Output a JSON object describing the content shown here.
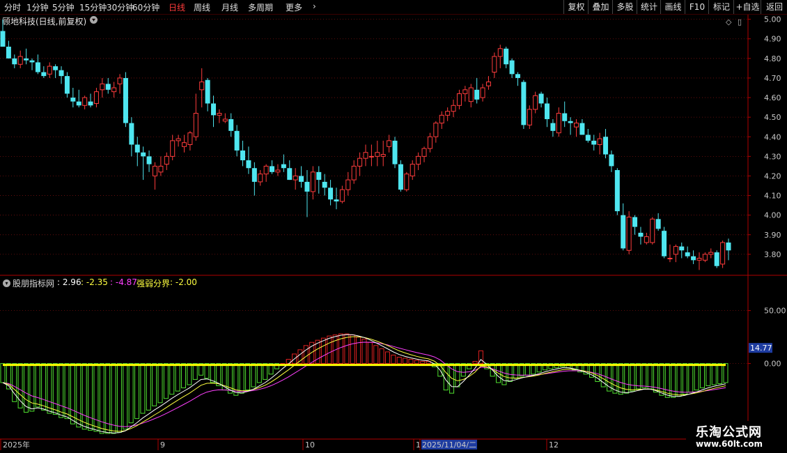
{
  "toolbar": {
    "periods": [
      {
        "label": "分时",
        "active": false
      },
      {
        "label": "1分钟",
        "active": false
      },
      {
        "label": "5分钟",
        "active": false
      },
      {
        "label": "15分钟",
        "active": false
      },
      {
        "label": "30分钟",
        "active": false
      },
      {
        "label": "60分钟",
        "active": false
      },
      {
        "label": "日线",
        "active": true
      },
      {
        "label": "周线",
        "active": false
      },
      {
        "label": "月线",
        "active": false
      },
      {
        "label": "多周期",
        "active": false
      },
      {
        "label": "更多",
        "active": false
      }
    ],
    "more_icon": "chevron-right-icon",
    "right_buttons": [
      "复权",
      "叠加",
      "多股",
      "统计",
      "画线",
      "F10",
      "标记",
      "+自选",
      "返回"
    ]
  },
  "stock_title": "顾地科技(日线,前复权)",
  "indicator": {
    "name": "股朋指标网",
    "v1": ": 2.96",
    "v2": ": -2.35",
    "v3": ": -4.87",
    "label4": "强弱分界",
    "v4": ": -2.00"
  },
  "colors": {
    "up": "#ff3c3c",
    "down": "#4fe6f0",
    "axis": "#b00000",
    "gridline": "#7a1010",
    "hist_pos": "#e02020",
    "hist_neg": "#50e030",
    "line_white": "#ffffff",
    "line_yellow": "#ffff40",
    "line_magenta": "#ff40ff",
    "zero_line": "#ffff00",
    "highlight_box": "#1e3ca0"
  },
  "chart_data": [
    {
      "type": "candlestick",
      "title": "顾地科技(日线,前复权)",
      "y_ticks": [
        "5.00",
        "4.90",
        "4.80",
        "4.70",
        "4.60",
        "4.50",
        "4.40",
        "4.30",
        "4.20",
        "4.10",
        "4.00",
        "3.90",
        "3.80"
      ],
      "ylim": [
        3.7,
        5.02
      ],
      "x_labels": [
        "2025年",
        "9",
        "10",
        "1",
        "2025/11/04/二",
        "12"
      ],
      "ohlc": [
        [
          4.94,
          5.0,
          4.86,
          4.86
        ],
        [
          4.86,
          4.89,
          4.8,
          4.8
        ],
        [
          4.8,
          4.82,
          4.75,
          4.77
        ],
        [
          4.77,
          4.84,
          4.75,
          4.81
        ],
        [
          4.8,
          4.85,
          4.77,
          4.79
        ],
        [
          4.79,
          4.8,
          4.74,
          4.78
        ],
        [
          4.78,
          4.82,
          4.72,
          4.73
        ],
        [
          4.73,
          4.76,
          4.7,
          4.71
        ],
        [
          4.72,
          4.78,
          4.7,
          4.76
        ],
        [
          4.76,
          4.77,
          4.7,
          4.74
        ],
        [
          4.74,
          4.76,
          4.67,
          4.71
        ],
        [
          4.71,
          4.73,
          4.6,
          4.62
        ],
        [
          4.6,
          4.65,
          4.55,
          4.58
        ],
        [
          4.58,
          4.64,
          4.55,
          4.56
        ],
        [
          4.56,
          4.61,
          4.54,
          4.6
        ],
        [
          4.58,
          4.62,
          4.55,
          4.56
        ],
        [
          4.57,
          4.65,
          4.55,
          4.63
        ],
        [
          4.64,
          4.7,
          4.6,
          4.67
        ],
        [
          4.67,
          4.7,
          4.62,
          4.64
        ],
        [
          4.63,
          4.68,
          4.6,
          4.65
        ],
        [
          4.67,
          4.72,
          4.62,
          4.7
        ],
        [
          4.7,
          4.73,
          4.45,
          4.47
        ],
        [
          4.47,
          4.5,
          4.3,
          4.36
        ],
        [
          4.36,
          4.4,
          4.25,
          4.32
        ],
        [
          4.32,
          4.35,
          4.18,
          4.3
        ],
        [
          4.3,
          4.33,
          4.22,
          4.26
        ],
        [
          4.2,
          4.27,
          4.13,
          4.25
        ],
        [
          4.22,
          4.3,
          4.2,
          4.25
        ],
        [
          4.26,
          4.32,
          4.23,
          4.3
        ],
        [
          4.3,
          4.41,
          4.28,
          4.38
        ],
        [
          4.38,
          4.41,
          4.35,
          4.39
        ],
        [
          4.35,
          4.41,
          4.32,
          4.37
        ],
        [
          4.36,
          4.43,
          4.33,
          4.42
        ],
        [
          4.4,
          4.62,
          4.38,
          4.52
        ],
        [
          4.64,
          4.75,
          4.55,
          4.68
        ],
        [
          4.69,
          4.7,
          4.53,
          4.57
        ],
        [
          4.57,
          4.61,
          4.45,
          4.51
        ],
        [
          4.51,
          4.54,
          4.47,
          4.52
        ],
        [
          4.48,
          4.52,
          4.47,
          4.49
        ],
        [
          4.49,
          4.52,
          4.4,
          4.43
        ],
        [
          4.43,
          4.46,
          4.3,
          4.33
        ],
        [
          4.33,
          4.38,
          4.25,
          4.28
        ],
        [
          4.28,
          4.35,
          4.21,
          4.24
        ],
        [
          4.24,
          4.27,
          4.1,
          4.17
        ],
        [
          4.17,
          4.23,
          4.15,
          4.21
        ],
        [
          4.21,
          4.26,
          4.17,
          4.25
        ],
        [
          4.25,
          4.28,
          4.21,
          4.22
        ],
        [
          4.22,
          4.26,
          4.2,
          4.23
        ],
        [
          4.26,
          4.31,
          4.22,
          4.24
        ],
        [
          4.24,
          4.28,
          4.18,
          4.18
        ],
        [
          4.18,
          4.24,
          4.13,
          4.2
        ],
        [
          4.2,
          4.25,
          4.14,
          4.17
        ],
        [
          4.17,
          4.23,
          3.99,
          4.12
        ],
        [
          4.12,
          4.25,
          4.08,
          4.22
        ],
        [
          4.22,
          4.25,
          4.11,
          4.18
        ],
        [
          4.17,
          4.21,
          4.1,
          4.14
        ],
        [
          4.14,
          4.18,
          4.05,
          4.08
        ],
        [
          4.08,
          4.14,
          4.03,
          4.07
        ],
        [
          4.07,
          4.15,
          4.06,
          4.13
        ],
        [
          4.13,
          4.22,
          4.1,
          4.18
        ],
        [
          4.18,
          4.28,
          4.16,
          4.25
        ],
        [
          4.25,
          4.32,
          4.2,
          4.29
        ],
        [
          4.29,
          4.36,
          4.25,
          4.32
        ],
        [
          4.3,
          4.36,
          4.25,
          4.3
        ],
        [
          4.3,
          4.38,
          4.25,
          4.32
        ],
        [
          4.3,
          4.38,
          4.25,
          4.31
        ],
        [
          4.35,
          4.41,
          4.32,
          4.38
        ],
        [
          4.38,
          4.4,
          4.24,
          4.26
        ],
        [
          4.26,
          4.28,
          4.12,
          4.13
        ],
        [
          4.13,
          4.22,
          4.12,
          4.21
        ],
        [
          4.2,
          4.28,
          4.18,
          4.26
        ],
        [
          4.26,
          4.32,
          4.23,
          4.3
        ],
        [
          4.3,
          4.35,
          4.27,
          4.34
        ],
        [
          4.34,
          4.42,
          4.32,
          4.4
        ],
        [
          4.4,
          4.48,
          4.37,
          4.47
        ],
        [
          4.47,
          4.53,
          4.44,
          4.51
        ],
        [
          4.51,
          4.55,
          4.48,
          4.53
        ],
        [
          4.53,
          4.59,
          4.5,
          4.56
        ],
        [
          4.56,
          4.64,
          4.54,
          4.62
        ],
        [
          4.62,
          4.66,
          4.58,
          4.64
        ],
        [
          4.58,
          4.67,
          4.55,
          4.65
        ],
        [
          4.64,
          4.7,
          4.57,
          4.59
        ],
        [
          4.6,
          4.67,
          4.58,
          4.65
        ],
        [
          4.66,
          4.71,
          4.64,
          4.68
        ],
        [
          4.73,
          4.83,
          4.7,
          4.81
        ],
        [
          4.81,
          4.87,
          4.75,
          4.85
        ],
        [
          4.85,
          4.86,
          4.75,
          4.77
        ],
        [
          4.79,
          4.8,
          4.7,
          4.72
        ],
        [
          4.72,
          4.73,
          4.66,
          4.7
        ],
        [
          4.68,
          4.69,
          4.44,
          4.46
        ],
        [
          4.46,
          4.56,
          4.44,
          4.54
        ],
        [
          4.54,
          4.63,
          4.52,
          4.61
        ],
        [
          4.62,
          4.63,
          4.55,
          4.57
        ],
        [
          4.57,
          4.6,
          4.45,
          4.49
        ],
        [
          4.47,
          4.49,
          4.4,
          4.43
        ],
        [
          4.42,
          4.55,
          4.4,
          4.52
        ],
        [
          4.52,
          4.58,
          4.45,
          4.48
        ],
        [
          4.48,
          4.5,
          4.41,
          4.47
        ],
        [
          4.45,
          4.49,
          4.4,
          4.47
        ],
        [
          4.47,
          4.49,
          4.41,
          4.41
        ],
        [
          4.41,
          4.44,
          4.37,
          4.38
        ],
        [
          4.38,
          4.41,
          4.33,
          4.36
        ],
        [
          4.36,
          4.42,
          4.31,
          4.39
        ],
        [
          4.4,
          4.44,
          4.29,
          4.31
        ],
        [
          4.31,
          4.33,
          4.22,
          4.25
        ],
        [
          4.23,
          4.24,
          4.0,
          4.02
        ],
        [
          4.0,
          4.06,
          3.82,
          3.83
        ],
        [
          3.82,
          4.02,
          3.8,
          3.99
        ],
        [
          3.99,
          4.0,
          3.9,
          3.94
        ],
        [
          3.91,
          3.94,
          3.85,
          3.89
        ],
        [
          3.86,
          3.91,
          3.85,
          3.89
        ],
        [
          3.86,
          3.99,
          3.85,
          3.98
        ],
        [
          3.98,
          4.01,
          3.92,
          3.93
        ],
        [
          3.92,
          3.94,
          3.78,
          3.79
        ],
        [
          3.78,
          3.85,
          3.76,
          3.78
        ],
        [
          3.8,
          3.85,
          3.76,
          3.84
        ],
        [
          3.84,
          3.86,
          3.78,
          3.82
        ],
        [
          3.81,
          3.84,
          3.78,
          3.79
        ],
        [
          3.79,
          3.82,
          3.75,
          3.77
        ],
        [
          3.77,
          3.81,
          3.72,
          3.78
        ],
        [
          3.77,
          3.81,
          3.76,
          3.8
        ],
        [
          3.8,
          3.83,
          3.78,
          3.81
        ],
        [
          3.81,
          3.82,
          3.73,
          3.74
        ],
        [
          3.75,
          3.87,
          3.73,
          3.86
        ],
        [
          3.86,
          3.88,
          3.77,
          3.82
        ]
      ]
    },
    {
      "type": "bar",
      "title": "股朋指标网",
      "y_ticks": [
        "50.00",
        "0.00"
      ],
      "current_value_tag": "14.77",
      "ylim": [
        -70,
        82
      ],
      "x_labels": [
        "2025年",
        "9",
        "10",
        "1",
        "2025/11/04/二",
        "12"
      ],
      "values": [
        -18,
        -24,
        -36,
        -42,
        -46,
        -45,
        -41,
        -44,
        -47,
        -48,
        -51,
        -52,
        -57,
        -60,
        -62,
        -63,
        -64,
        -66,
        -66,
        -66,
        -65,
        -62,
        -56,
        -52,
        -47,
        -44,
        -40,
        -37,
        -33,
        -29,
        -26,
        -23,
        -20,
        -15,
        -11,
        -14,
        -18,
        -21,
        -25,
        -28,
        -30,
        -28,
        -25,
        -22,
        -18,
        -15,
        -10,
        -5,
        0,
        4,
        9,
        13,
        17,
        20,
        22,
        24,
        26,
        27,
        28,
        28,
        27,
        25,
        23,
        20,
        17,
        14,
        11,
        8,
        6,
        5,
        4,
        3,
        2,
        2,
        -3,
        -12,
        -25,
        -28,
        -22,
        -12,
        -5,
        2,
        12,
        -5,
        -12,
        -18,
        -20,
        -17,
        -14,
        -12,
        -11,
        -10,
        -8,
        -6,
        -5,
        -4,
        -3,
        -4,
        -6,
        -8,
        -10,
        -13,
        -17,
        -22,
        -26,
        -28,
        -29,
        -28,
        -26,
        -24,
        -23,
        -24,
        -27,
        -30,
        -32,
        -32,
        -31,
        -29,
        -27,
        -25,
        -23,
        -21,
        -20,
        -19,
        -18
      ],
      "series": [
        {
          "name": "2.96",
          "color": "#ffffff"
        },
        {
          "name": "-2.35",
          "color": "#ffff40"
        },
        {
          "name": "-4.87",
          "color": "#ff40ff"
        }
      ],
      "zero_line_value": -2.0
    }
  ],
  "watermark": {
    "title": "乐淘公式网",
    "url": "www.60lt.com"
  }
}
